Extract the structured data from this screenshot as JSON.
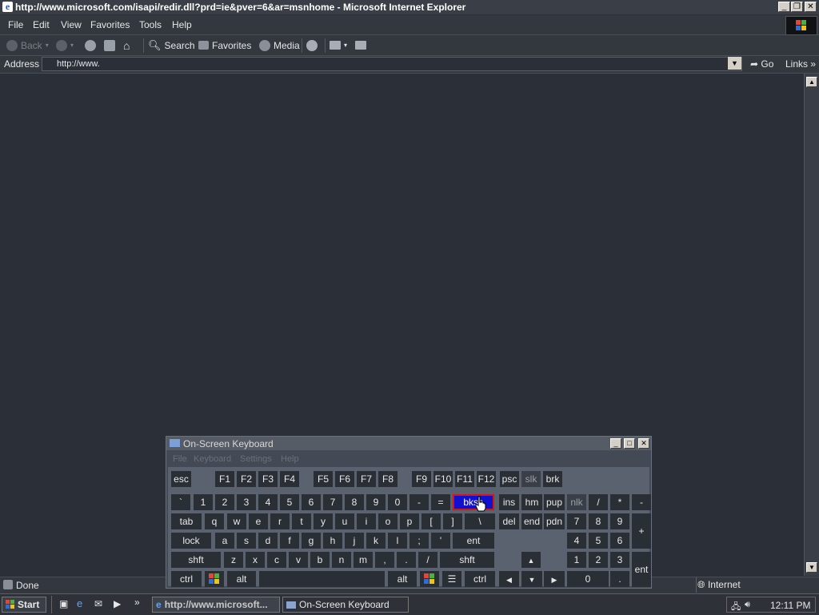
{
  "window": {
    "title": "http://www.microsoft.com/isapi/redir.dll?prd=ie&pver=6&ar=msnhome - Microsoft Internet Explorer",
    "caption_buttons": [
      "minimize",
      "restore",
      "close"
    ]
  },
  "menubar": {
    "items": [
      "File",
      "Edit",
      "View",
      "Favorites",
      "Tools",
      "Help"
    ]
  },
  "toolbar": {
    "back": "Back",
    "search": "Search",
    "favorites": "Favorites",
    "media": "Media"
  },
  "address": {
    "label": "Address",
    "value": "http://www.",
    "go": "Go",
    "links": "Links"
  },
  "status": {
    "text": "Done",
    "zone": "Internet"
  },
  "taskbar": {
    "start": "Start",
    "tasks": [
      "http://www.microsoft...",
      "On-Screen Keyboard"
    ],
    "clock": "12:11 PM"
  },
  "osk": {
    "title": "On-Screen Keyboard",
    "menu": [
      "File",
      "Keyboard",
      "Settings",
      "Help"
    ],
    "rows": {
      "fn": [
        "esc",
        "F1",
        "F2",
        "F3",
        "F4",
        "F5",
        "F6",
        "F7",
        "F8",
        "F9",
        "F10",
        "F11",
        "F12",
        "psc",
        "slk",
        "brk"
      ],
      "num": [
        "`",
        "1",
        "2",
        "3",
        "4",
        "5",
        "6",
        "7",
        "8",
        "9",
        "0",
        "-",
        "=",
        "bksp",
        "ins",
        "hm",
        "pup",
        "nlk",
        "/",
        "*",
        "-"
      ],
      "tab": [
        "tab",
        "q",
        "w",
        "e",
        "r",
        "t",
        "y",
        "u",
        "i",
        "o",
        "p",
        "[",
        "]",
        "\\",
        "del",
        "end",
        "pdn",
        "7",
        "8",
        "9",
        "+"
      ],
      "home": [
        "lock",
        "a",
        "s",
        "d",
        "f",
        "g",
        "h",
        "j",
        "k",
        "l",
        ";",
        "'",
        "ent",
        "4",
        "5",
        "6"
      ],
      "shift": [
        "shft",
        "z",
        "x",
        "c",
        "v",
        "b",
        "n",
        "m",
        ",",
        ".",
        "/",
        "shft",
        "1",
        "2",
        "3",
        "ent"
      ],
      "bottom": [
        "ctrl",
        "alt",
        "alt",
        "ctrl",
        "0",
        "."
      ]
    },
    "active_key": "bksp"
  }
}
